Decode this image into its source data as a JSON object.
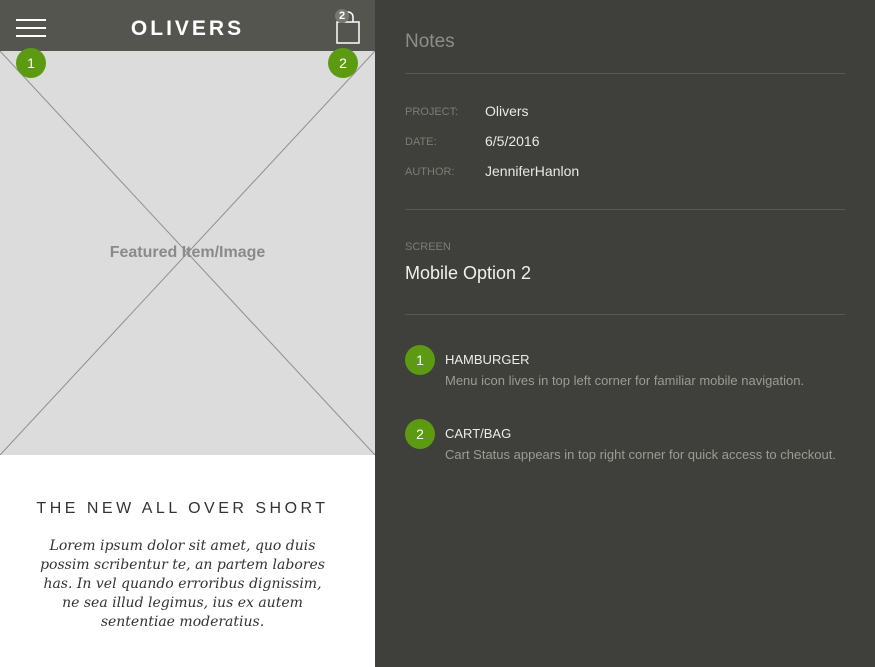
{
  "mobile": {
    "brand": "OLIVERS",
    "cart_count": "2",
    "featured_label": "Featured Item/Image",
    "product_title": "THE NEW ALL OVER SHORT",
    "product_description": "Lorem ipsum dolor sit amet, quo duis possim scribentur te, an partem labores has. In vel quando erroribus dignissim, ne sea illud legimus, ius ex autem sententiae moderatius.",
    "markers": [
      "1",
      "2"
    ],
    "header_color": "#555550",
    "marker_color": "#5c9a12",
    "icons": [
      "hamburger-icon",
      "shopping-bag-icon"
    ]
  },
  "notes": {
    "title": "Notes",
    "meta": {
      "project_label": "PROJECT:",
      "project_value": "Olivers",
      "date_label": "DATE:",
      "date_value": "6/5/2016",
      "author_label": "AUTHOR:",
      "author_value": "JenniferHanlon"
    },
    "screen_label": "SCREEN",
    "screen_name": "Mobile Option 2",
    "annotations": [
      {
        "number": "1",
        "title": "HAMBURGER",
        "description": "Menu icon lives in top left corner for familiar mobile navigation."
      },
      {
        "number": "2",
        "title": "CART/BAG",
        "description": "Cart Status appears in top right corner for quick access to checkout."
      }
    ],
    "panel_color": "#3f3f3b"
  }
}
